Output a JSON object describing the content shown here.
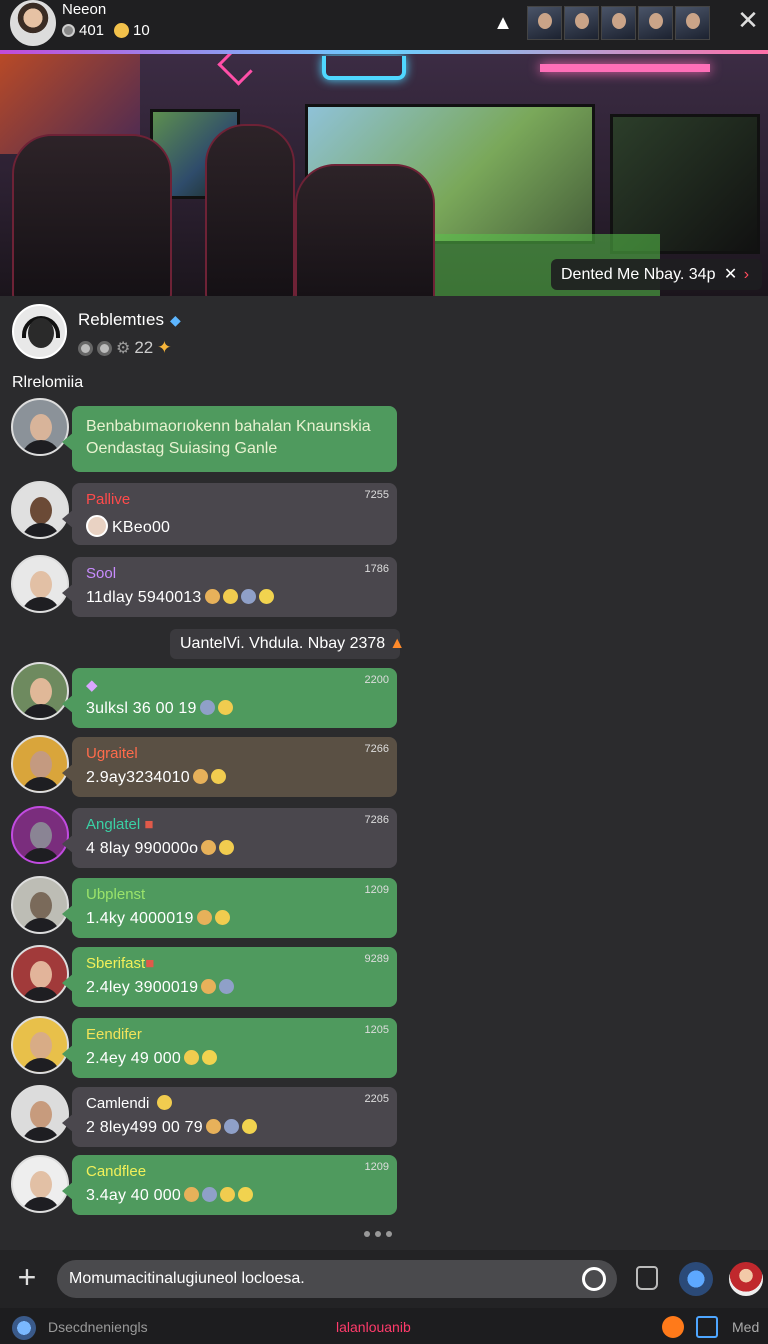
{
  "header": {
    "host_name": "Neeon",
    "host_coins": "401",
    "host_likes": "10",
    "icons": {
      "gift": "gift-icon",
      "close": "close-icon"
    },
    "viewer_count_shown": 5
  },
  "stream": {
    "banner_text": "Dented Me Nbay. 34p",
    "banner_close": "✕",
    "banner_arrow": "›"
  },
  "streamer": {
    "name": "Reblemtıes",
    "stat_value": "22",
    "section_label": "Rlrelomiia"
  },
  "chat": {
    "first_message": {
      "line1": "Benbabımaorıokenn bahalan Knaunskia",
      "line2": "Oendastag Suiasing Ganle"
    },
    "messages": [
      {
        "name": "Pallive",
        "time": "7255",
        "text": "KBeo00",
        "name_color": "#ff4b4b"
      },
      {
        "name": "Sool",
        "time": "1786",
        "text": "11dlay 5940013",
        "name_color": "#c98cff"
      },
      {
        "name": "",
        "time": "2200",
        "text": "3ulksl 36 00 19",
        "name_color": "#3ad1c5"
      },
      {
        "name": "Ugraitel",
        "time": "7266",
        "text": "2.9ay3234010",
        "name_color": "#ff6b4b"
      },
      {
        "name": "Anglatel",
        "time": "7286",
        "text": "4 8lay 990000o",
        "name_color": "#3ad1a5"
      },
      {
        "name": "Ubplenst",
        "time": "1209",
        "text": "1.4ky 4000019",
        "name_color": "#9be36b"
      },
      {
        "name": "Sberifast",
        "time": "9289",
        "text": "2.4ley 3900019",
        "name_color": "#f2f05a"
      },
      {
        "name": "Eendifer",
        "time": "1205",
        "text": "2.4ey 49 000",
        "name_color": "#f2e35a"
      },
      {
        "name": "Camlendi",
        "time": "2205",
        "text": "2 8ley499 00 79",
        "name_color": "#ffffff"
      },
      {
        "name": "Candflee",
        "time": "1209",
        "text": "3.4ay 40 000",
        "name_color": "#f2f05a"
      }
    ],
    "system_message": "UantelVi. Vhdula. Nbay 2378"
  },
  "input": {
    "placeholder": "Momumacitinalugiuneol locloesa."
  },
  "bottom_bar": {
    "left_label": "Dsecdneniengls",
    "center_link": "lalanlouanib",
    "right_label": "Med"
  }
}
